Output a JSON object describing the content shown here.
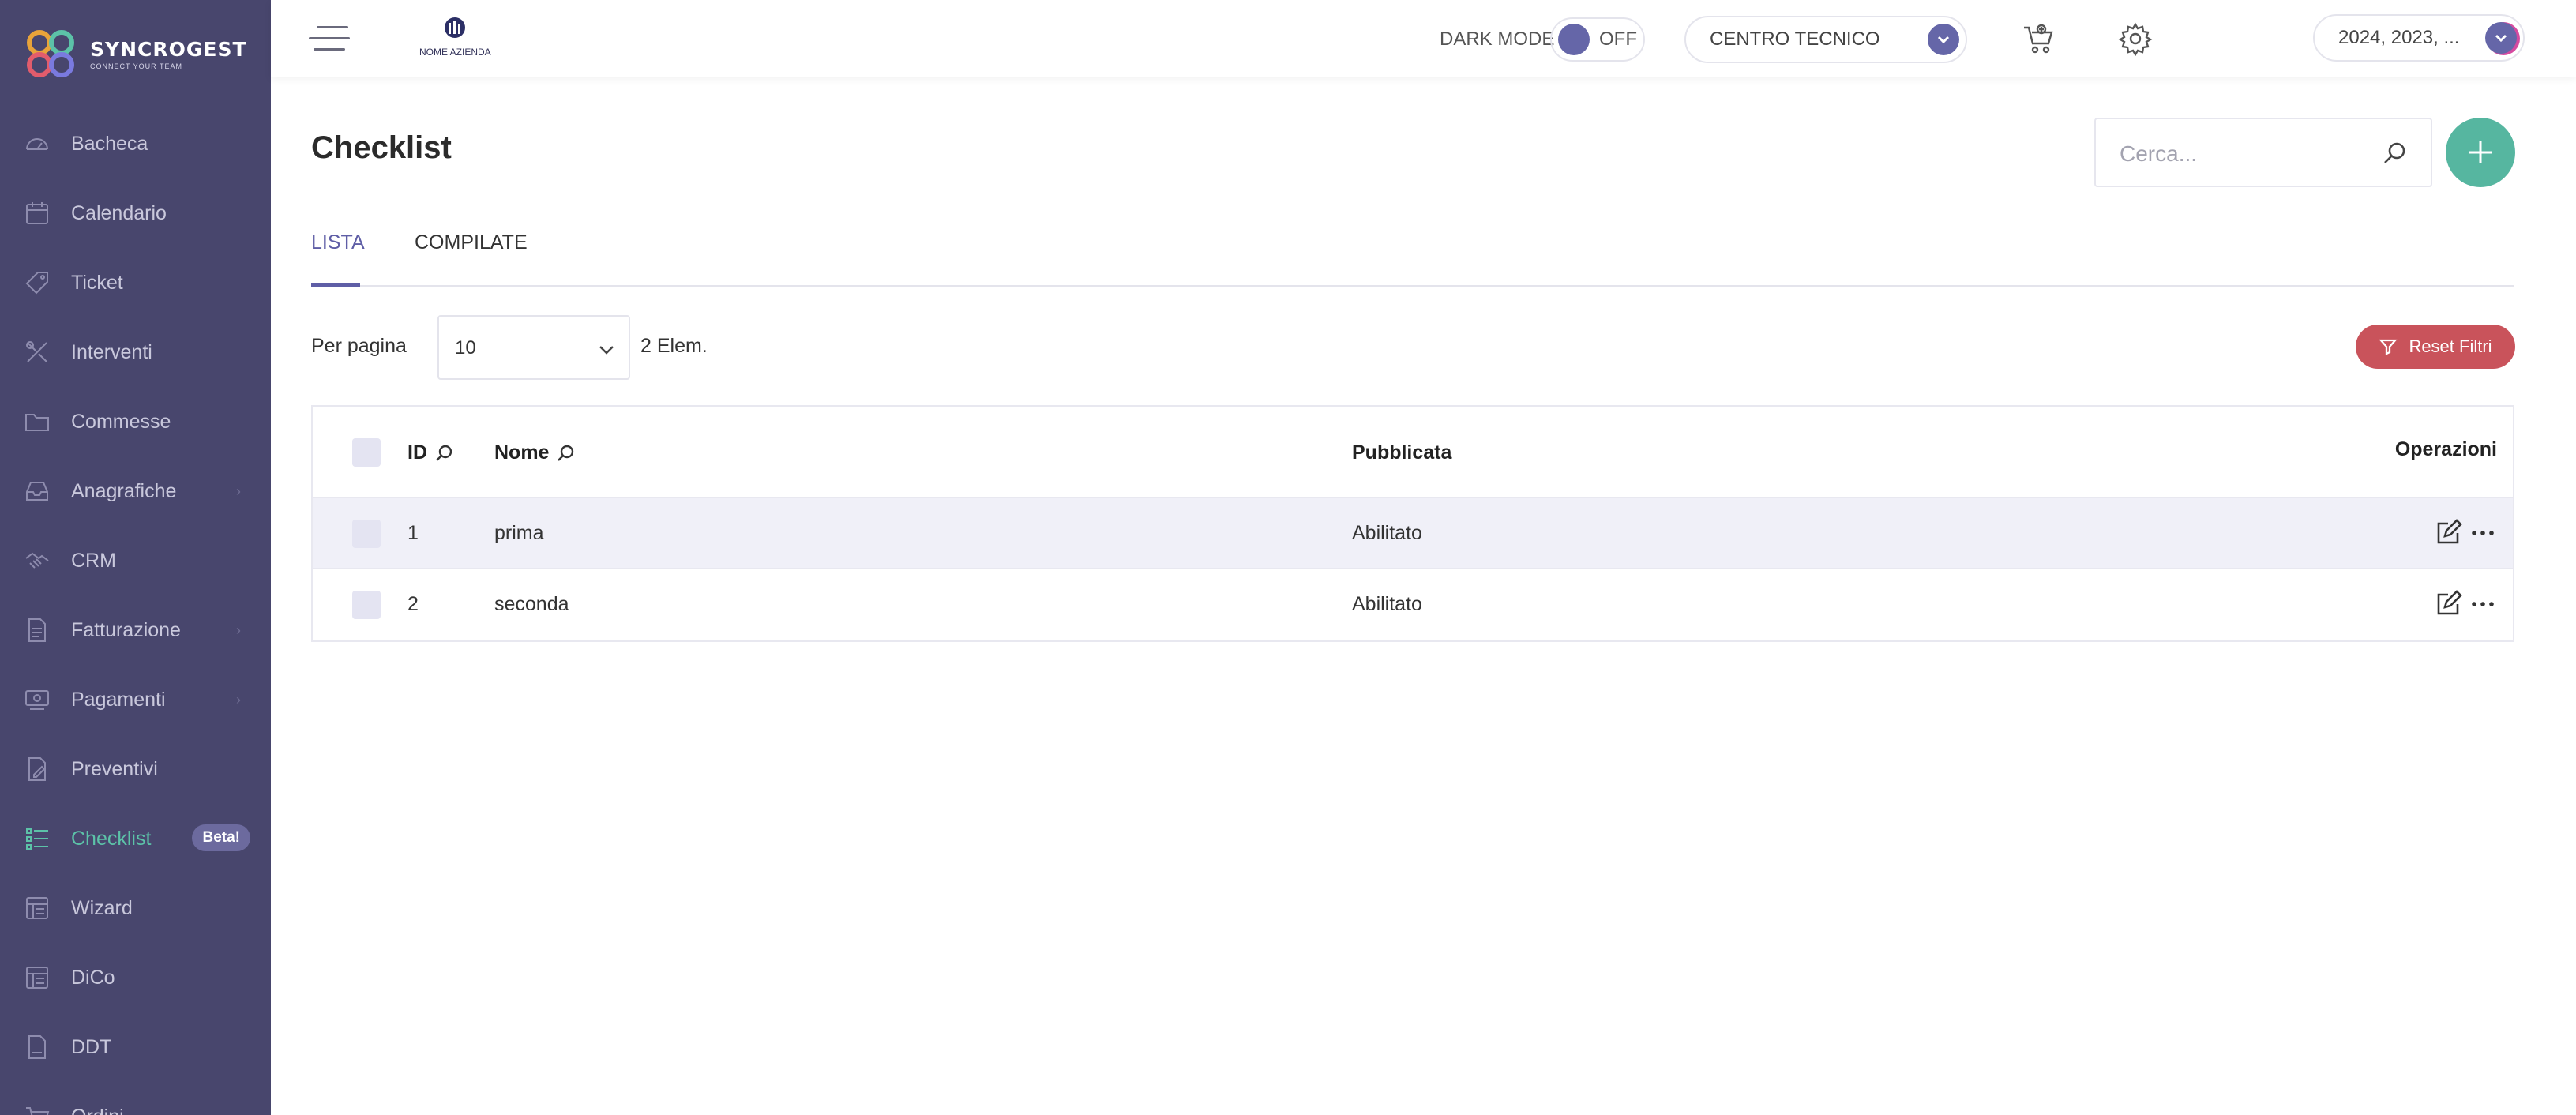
{
  "brand": {
    "name": "SYNCROGEST",
    "tagline": "CONNECT YOUR TEAM"
  },
  "sidebar": {
    "items": [
      {
        "label": "Bacheca",
        "icon": "dashboard-icon"
      },
      {
        "label": "Calendario",
        "icon": "calendar-icon"
      },
      {
        "label": "Ticket",
        "icon": "ticket-icon"
      },
      {
        "label": "Interventi",
        "icon": "tools-icon"
      },
      {
        "label": "Commesse",
        "icon": "folder-icon"
      },
      {
        "label": "Anagrafiche",
        "icon": "inbox-icon",
        "has_submenu": true
      },
      {
        "label": "CRM",
        "icon": "handshake-icon"
      },
      {
        "label": "Fatturazione",
        "icon": "invoice-icon",
        "has_submenu": true
      },
      {
        "label": "Pagamenti",
        "icon": "payments-icon",
        "has_submenu": true
      },
      {
        "label": "Preventivi",
        "icon": "quote-icon"
      },
      {
        "label": "Checklist",
        "icon": "checklist-icon",
        "active": true,
        "badge": "Beta!"
      },
      {
        "label": "Wizard",
        "icon": "wizard-icon"
      },
      {
        "label": "DiCo",
        "icon": "dico-icon"
      },
      {
        "label": "DDT",
        "icon": "ddt-icon"
      },
      {
        "label": "Ordini",
        "icon": "orders-icon"
      }
    ]
  },
  "topbar": {
    "company_logo_text": "NOME AZIENDA",
    "dark_mode_label": "DARK MODE",
    "dark_mode_state": "OFF",
    "department": "CENTRO TECNICO",
    "years": "2024, 2023, ..."
  },
  "page": {
    "title": "Checklist",
    "search_placeholder": "Cerca...",
    "tabs": [
      {
        "label": "LISTA",
        "active": true
      },
      {
        "label": "COMPILATE",
        "active": false
      }
    ],
    "per_page_label": "Per pagina",
    "per_page_value": "10",
    "count_text": "2 Elem.",
    "reset_filters": "Reset Filtri"
  },
  "table": {
    "headers": {
      "id": "ID",
      "name": "Nome",
      "published": "Pubblicata",
      "operations": "Operazioni"
    },
    "rows": [
      {
        "id": "1",
        "name": "prima",
        "published": "Abilitato"
      },
      {
        "id": "2",
        "name": "seconda",
        "published": "Abilitato"
      }
    ]
  },
  "colors": {
    "sidebar_bg": "#48466d",
    "accent": "#5f5ea6",
    "active_nav": "#5cc2a8",
    "add_button": "#56b6a0",
    "reset_button": "#c9535b"
  }
}
